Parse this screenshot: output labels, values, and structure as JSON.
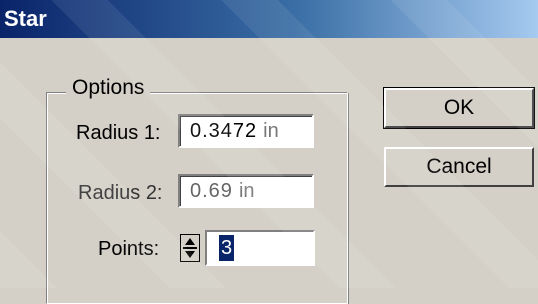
{
  "window": {
    "title": "Star"
  },
  "options": {
    "legend": "Options",
    "radius1": {
      "label": "Radius 1:",
      "value": "0.3472",
      "unit": "in"
    },
    "radius2": {
      "label": "Radius 2:",
      "value": "0.69",
      "unit": "in"
    },
    "points": {
      "label": "Points:",
      "value": "3"
    }
  },
  "buttons": {
    "ok": "OK",
    "cancel": "Cancel"
  },
  "colors": {
    "title_bar_start": "#0a246a",
    "title_bar_end": "#a6caf0",
    "dialog_bg": "#d4d0c8",
    "selection": "#0a246a"
  },
  "icons": {
    "stepper": "spin-arrows-icon"
  }
}
